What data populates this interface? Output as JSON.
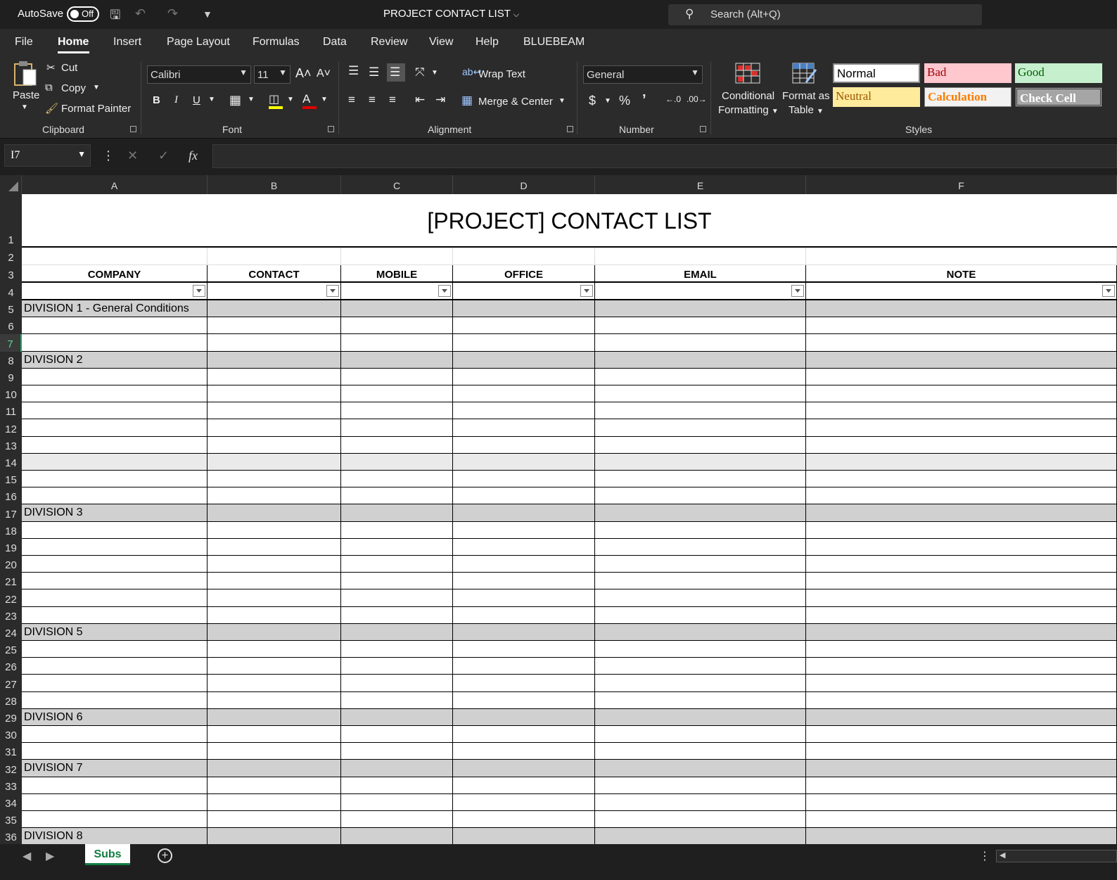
{
  "titlebar": {
    "autosave_label": "AutoSave",
    "autosave_state": "Off",
    "title": "PROJECT CONTACT LIST",
    "search_placeholder": "Search (Alt+Q)"
  },
  "menu": [
    "File",
    "Home",
    "Insert",
    "Page Layout",
    "Formulas",
    "Data",
    "Review",
    "View",
    "Help",
    "BLUEBEAM"
  ],
  "ribbon": {
    "clipboard": {
      "paste": "Paste",
      "cut": "Cut",
      "copy": "Copy",
      "format_painter": "Format Painter",
      "group": "Clipboard"
    },
    "font": {
      "name": "Calibri",
      "size": "11",
      "group": "Font"
    },
    "alignment": {
      "wrap": "Wrap Text",
      "merge": "Merge & Center",
      "group": "Alignment"
    },
    "number": {
      "format": "General",
      "group": "Number"
    },
    "conditional_1": "Conditional",
    "conditional_2": "Formatting",
    "format_table_1": "Format as",
    "format_table_2": "Table",
    "styles": {
      "group": "Styles",
      "normal": "Normal",
      "bad": "Bad",
      "good": "Good",
      "neutral": "Neutral",
      "calculation": "Calculation",
      "check_cell": "Check Cell"
    }
  },
  "formula_bar": {
    "name_box": "I7",
    "value": ""
  },
  "columns": [
    "A",
    "B",
    "C",
    "D",
    "E",
    "F"
  ],
  "sheet": {
    "title": "[PROJECT] CONTACT LIST",
    "headers": [
      "COMPANY",
      "CONTACT",
      "MOBILE",
      "OFFICE",
      "EMAIL",
      "NOTE"
    ],
    "row_numbers": [
      "1",
      "2",
      "3",
      "4",
      "5",
      "6",
      "7",
      "8",
      "9",
      "10",
      "11",
      "12",
      "13",
      "14",
      "15",
      "16",
      "17",
      "18",
      "19",
      "20",
      "21",
      "22",
      "23",
      "24",
      "25",
      "26",
      "27",
      "28",
      "29",
      "30",
      "31",
      "32",
      "33",
      "34",
      "35",
      "36"
    ],
    "divisions": {
      "5": "DIVISION  1 - General Conditions",
      "8": "DIVISION 2",
      "17": "DIVISION 3",
      "24": "DIVISION 5",
      "29": "DIVISION 6",
      "32": "DIVISION 7",
      "36": "DIVISION 8"
    },
    "selected_row": "7"
  },
  "sheet_tabs": {
    "active": "Subs"
  },
  "colors": {
    "accent": "#107c41",
    "division_fill": "#d0d0d0",
    "ribbon_bg": "#2b2b2b"
  }
}
